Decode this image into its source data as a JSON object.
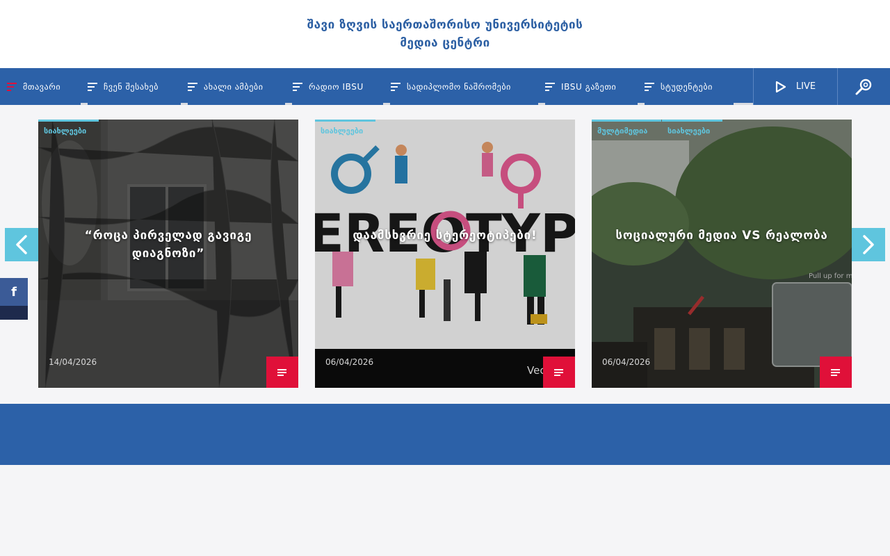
{
  "header": {
    "title_line1": "შავი ზღვის საერთაშორისო უნივერსიტეტის",
    "title_line2": "მედია ცენტრი"
  },
  "nav": {
    "items": [
      {
        "label": "მთავარი"
      },
      {
        "label": "ჩვენ შესახებ"
      },
      {
        "label": "ახალი ამბები"
      },
      {
        "label": "რადიო IBSU"
      },
      {
        "label": "სადიპლომო ნაშრომები"
      },
      {
        "label": "IBSU გაზეთი"
      },
      {
        "label": "სტუდენტები"
      }
    ],
    "live_label": "LIVE",
    "search_icon": "search-icon"
  },
  "social": {
    "facebook_label": "f"
  },
  "cards": [
    {
      "tags": [
        "სიახლეები"
      ],
      "title": "“როცა პირველად გავიგე დიაგნოზი”",
      "date": "14/04/2026",
      "icon": "article-icon"
    },
    {
      "tags": [
        "სიახლეები"
      ],
      "title": "დაამსხვრიე სტერეოტიპები!",
      "date": "06/04/2026",
      "image_text": "EREOTYP",
      "corner_text": "Vec",
      "icon": "article-icon"
    },
    {
      "tags": [
        "მულტიმედია",
        "სიახლეები"
      ],
      "title": "სოციალური მედია VS რეალობა",
      "date": "06/04/2026",
      "overlay_text": "Pull up for m",
      "icon": "article-icon"
    }
  ],
  "colors": {
    "brand_blue": "#2c61a8",
    "accent_cyan": "#5fc5de",
    "accent_red": "#e01039"
  }
}
